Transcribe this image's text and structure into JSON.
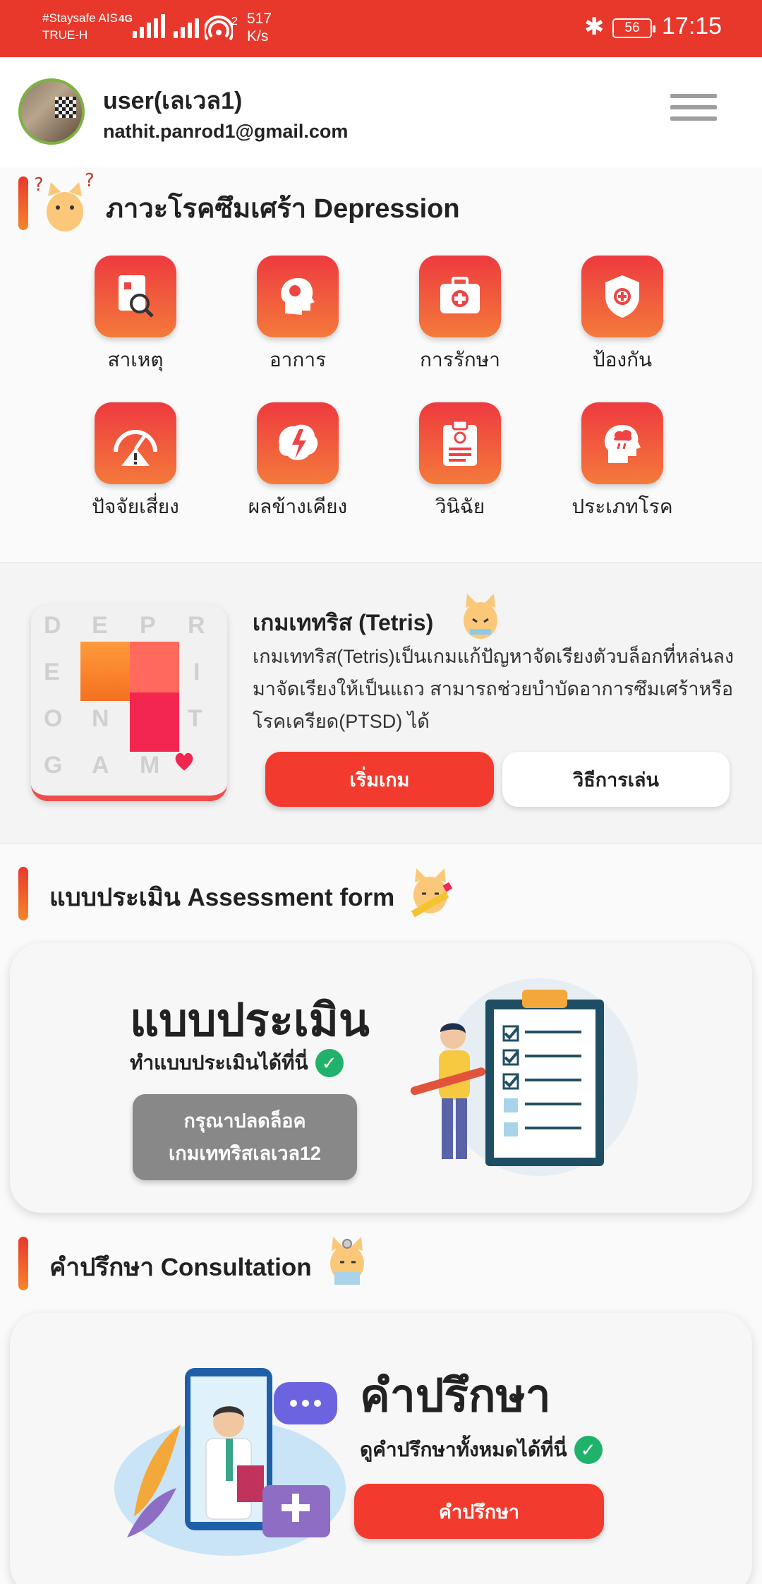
{
  "status_bar": {
    "carrier_line1": "#Staysafe AIS",
    "carrier_line2": "TRUE-H",
    "network_type": "4G",
    "wifi_index": "2",
    "speed_value": "517",
    "speed_unit": "K/s",
    "battery": "56",
    "time": "17:15"
  },
  "header": {
    "username": "user(เลเวล1)",
    "email": "nathit.panrod1@gmail.com"
  },
  "depression": {
    "title": "ภาวะโรคซึมเศร้า Depression",
    "items": [
      {
        "label": "สาเหตุ",
        "icon": "document-search-icon"
      },
      {
        "label": "อาการ",
        "icon": "head-virus-icon"
      },
      {
        "label": "การรักษา",
        "icon": "first-aid-kit-icon"
      },
      {
        "label": "ป้องกัน",
        "icon": "shield-icon"
      },
      {
        "label": "ปัจจัยเสี่ยง",
        "icon": "gauge-warning-icon"
      },
      {
        "label": "ผลข้างเคียง",
        "icon": "brain-lightning-icon"
      },
      {
        "label": "วินิฉัย",
        "icon": "clipboard-icon"
      },
      {
        "label": "ประเภทโรค",
        "icon": "head-storm-icon"
      }
    ]
  },
  "tetris": {
    "title": "เกมเททริส (Tetris)",
    "description": "เกมเททริส(Tetris)เป็นเกมแก้ปัญหาจัดเรียงตัวบล็อกที่หล่นลงมาจัดเรียงให้เป็นแถว สามารถช่วยบำบัดอาการซึมเศร้าหรือโรคเครียด(PTSD) ได้",
    "start_button": "เริ่มเกม",
    "howto_button": "วิธีการเล่น",
    "grid_letters": [
      "D",
      "E",
      "P",
      "R",
      "E",
      "I",
      "O",
      "N",
      "T",
      "G",
      "A",
      "M"
    ]
  },
  "assessment": {
    "section_title": "แบบประเมิน Assessment form",
    "card_title": "แบบประเมิน",
    "card_subtitle": "ทำแบบประเมินได้ที่นี่",
    "locked_line1": "กรุณาปลดล็อค",
    "locked_line2": "เกมเททริสเลเวล12"
  },
  "consultation": {
    "section_title": "คำปรึกษา Consultation",
    "card_title": "คำปรึกษา",
    "card_subtitle": "ดูคำปรึกษาทั้งหมดได้ที่นี่",
    "button": "คำปรึกษา"
  },
  "colors": {
    "primary_red": "#e8382c",
    "button_red": "#f23b2e",
    "tile_gradient_top": "#ee3a3f",
    "tile_gradient_bottom": "#f47a3b",
    "check_green": "#20b26b",
    "locked_gray": "#888888"
  }
}
